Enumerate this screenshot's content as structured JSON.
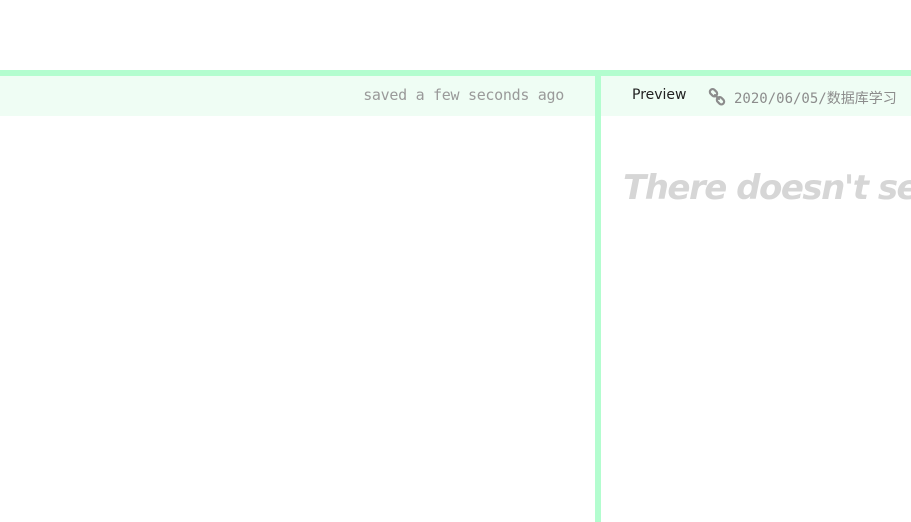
{
  "editor": {
    "save_status": "saved a few seconds ago"
  },
  "preview": {
    "label": "Preview",
    "link_icon": "link-icon",
    "permalink": "2020/06/05/数据库学习",
    "empty_message": "There doesn't seem to be anything here yet"
  },
  "colors": {
    "accent": "#b3fdcf",
    "bar_background": "#effdf4",
    "muted_text": "#9a9a9a",
    "placeholder_text": "#d6d6d6"
  }
}
